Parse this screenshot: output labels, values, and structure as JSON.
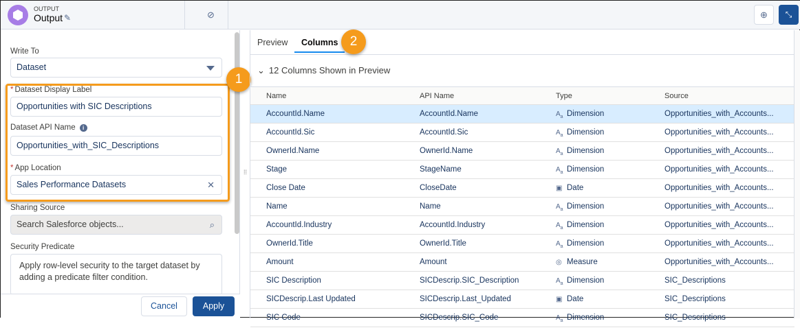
{
  "header": {
    "subtitle": "OUTPUT",
    "title": "Output",
    "icons": [
      "output-node-icon",
      "pencil-icon",
      "hide-icon",
      "data-preview-icon",
      "collapse-icon"
    ]
  },
  "left": {
    "write_to": {
      "label": "Write To",
      "value": "Dataset"
    },
    "display_label": {
      "label": "Dataset Display Label",
      "required": "*",
      "value": "Opportunities with SIC Descriptions"
    },
    "api_name": {
      "label": "Dataset API Name",
      "info": "i",
      "value": "Opportunities_with_SIC_Descriptions"
    },
    "app_location": {
      "label": "App Location",
      "required": "*",
      "value": "Sales Performance Datasets",
      "clear": "✕"
    },
    "sharing_source": {
      "label": "Sharing Source",
      "placeholder": "Search Salesforce objects..."
    },
    "security_predicate": {
      "label": "Security Predicate",
      "placeholder": "Apply row-level security to the target dataset by adding a predicate filter condition."
    },
    "cancel": "Cancel",
    "apply": "Apply"
  },
  "callouts": {
    "one": "1",
    "two": "2"
  },
  "accent": "#f59b1c",
  "brand": "#1b5297",
  "right": {
    "tabs": [
      {
        "label": "Preview"
      },
      {
        "label": "Columns",
        "active": true
      }
    ],
    "section": "12 Columns Shown in Preview",
    "columns": [
      "Name",
      "API Name",
      "Type",
      "Source"
    ],
    "rows": [
      {
        "name": "AccountId.Name",
        "api": "AccountId.Name",
        "type": "Dimension",
        "icon": "dimension-icon",
        "source": "Opportunities_with_Accounts..."
      },
      {
        "name": "AccountId.Sic",
        "api": "AccountId.Sic",
        "type": "Dimension",
        "icon": "dimension-icon",
        "source": "Opportunities_with_Accounts..."
      },
      {
        "name": "OwnerId.Name",
        "api": "OwnerId.Name",
        "type": "Dimension",
        "icon": "dimension-icon",
        "source": "Opportunities_with_Accounts..."
      },
      {
        "name": "Stage",
        "api": "StageName",
        "type": "Dimension",
        "icon": "dimension-icon",
        "source": "Opportunities_with_Accounts..."
      },
      {
        "name": "Close Date",
        "api": "CloseDate",
        "type": "Date",
        "icon": "date-icon",
        "source": "Opportunities_with_Accounts..."
      },
      {
        "name": "Name",
        "api": "Name",
        "type": "Dimension",
        "icon": "dimension-icon",
        "source": "Opportunities_with_Accounts..."
      },
      {
        "name": "AccountId.Industry",
        "api": "AccountId.Industry",
        "type": "Dimension",
        "icon": "dimension-icon",
        "source": "Opportunities_with_Accounts..."
      },
      {
        "name": "OwnerId.Title",
        "api": "OwnerId.Title",
        "type": "Dimension",
        "icon": "dimension-icon",
        "source": "Opportunities_with_Accounts..."
      },
      {
        "name": "Amount",
        "api": "Amount",
        "type": "Measure",
        "icon": "measure-icon",
        "source": "Opportunities_with_Accounts..."
      },
      {
        "name": "SIC Description",
        "api": "SICDescrip.SIC_Description",
        "type": "Dimension",
        "icon": "dimension-icon",
        "source": "SIC_Descriptions"
      },
      {
        "name": "SICDescrip.Last Updated",
        "api": "SICDescrip.Last_Updated",
        "type": "Date",
        "icon": "date-icon",
        "source": "SIC_Descriptions"
      },
      {
        "name": "SIC Code",
        "api": "SICDescrip.SIC_Code",
        "type": "Dimension",
        "icon": "dimension-icon",
        "source": "SIC_Descriptions"
      }
    ]
  }
}
